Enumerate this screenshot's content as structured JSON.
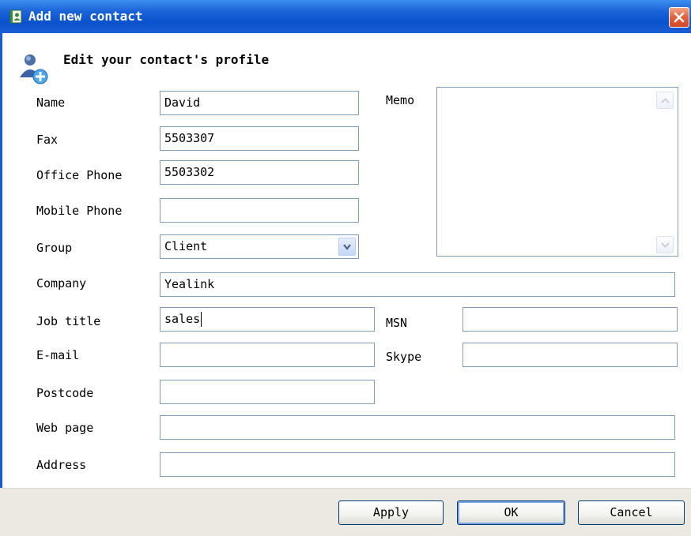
{
  "window": {
    "title": "Add new contact"
  },
  "header": {
    "text": "Edit your contact's profile"
  },
  "fields": {
    "name": {
      "label": "Name",
      "value": "David"
    },
    "fax": {
      "label": "Fax",
      "value": "5503307"
    },
    "office_phone": {
      "label": "Office Phone",
      "value": "5503302"
    },
    "mobile_phone": {
      "label": "Mobile Phone",
      "value": ""
    },
    "group": {
      "label": "Group",
      "value": "Client"
    },
    "company": {
      "label": "Company",
      "value": "Yealink"
    },
    "job_title": {
      "label": "Job title",
      "value": "sales"
    },
    "email": {
      "label": "E-mail",
      "value": ""
    },
    "postcode": {
      "label": "Postcode",
      "value": ""
    },
    "web_page": {
      "label": "Web page",
      "value": ""
    },
    "address": {
      "label": "Address",
      "value": ""
    },
    "memo": {
      "label": "Memo",
      "value": ""
    },
    "msn": {
      "label": "MSN",
      "value": ""
    },
    "skype": {
      "label": "Skype",
      "value": ""
    }
  },
  "buttons": {
    "apply": "Apply",
    "ok": "OK",
    "cancel": "Cancel"
  },
  "icons": {
    "title": "contact-book-icon",
    "header": "add-contact-icon",
    "close": "close-icon",
    "dropdown": "chevron-down-icon"
  },
  "colors": {
    "titlebar": "#0a52cc",
    "close": "#e2603a",
    "field_border": "#7f9db9",
    "footer": "#ece9e3"
  }
}
